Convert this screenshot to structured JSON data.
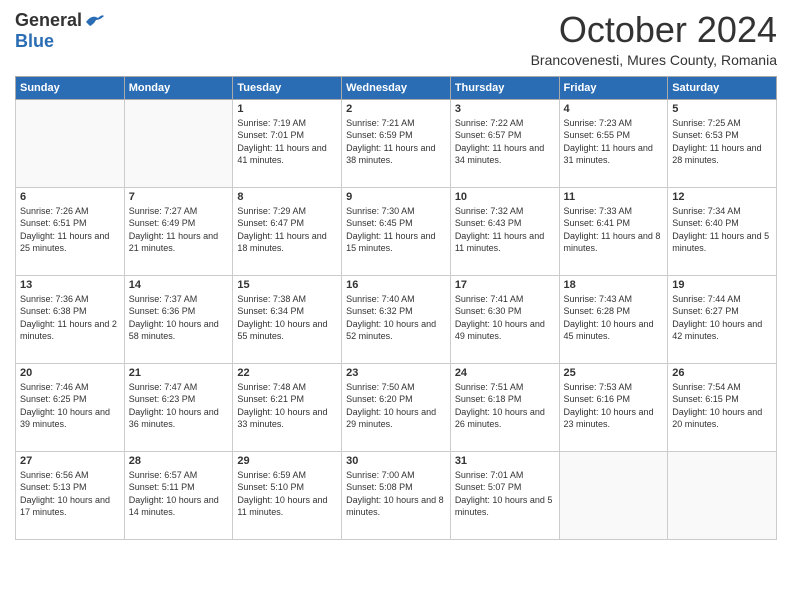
{
  "logo": {
    "general": "General",
    "blue": "Blue"
  },
  "header": {
    "month": "October 2024",
    "location": "Brancovenesti, Mures County, Romania"
  },
  "weekdays": [
    "Sunday",
    "Monday",
    "Tuesday",
    "Wednesday",
    "Thursday",
    "Friday",
    "Saturday"
  ],
  "weeks": [
    [
      {
        "day": "",
        "sunrise": "",
        "sunset": "",
        "daylight": ""
      },
      {
        "day": "",
        "sunrise": "",
        "sunset": "",
        "daylight": ""
      },
      {
        "day": "1",
        "sunrise": "Sunrise: 7:19 AM",
        "sunset": "Sunset: 7:01 PM",
        "daylight": "Daylight: 11 hours and 41 minutes."
      },
      {
        "day": "2",
        "sunrise": "Sunrise: 7:21 AM",
        "sunset": "Sunset: 6:59 PM",
        "daylight": "Daylight: 11 hours and 38 minutes."
      },
      {
        "day": "3",
        "sunrise": "Sunrise: 7:22 AM",
        "sunset": "Sunset: 6:57 PM",
        "daylight": "Daylight: 11 hours and 34 minutes."
      },
      {
        "day": "4",
        "sunrise": "Sunrise: 7:23 AM",
        "sunset": "Sunset: 6:55 PM",
        "daylight": "Daylight: 11 hours and 31 minutes."
      },
      {
        "day": "5",
        "sunrise": "Sunrise: 7:25 AM",
        "sunset": "Sunset: 6:53 PM",
        "daylight": "Daylight: 11 hours and 28 minutes."
      }
    ],
    [
      {
        "day": "6",
        "sunrise": "Sunrise: 7:26 AM",
        "sunset": "Sunset: 6:51 PM",
        "daylight": "Daylight: 11 hours and 25 minutes."
      },
      {
        "day": "7",
        "sunrise": "Sunrise: 7:27 AM",
        "sunset": "Sunset: 6:49 PM",
        "daylight": "Daylight: 11 hours and 21 minutes."
      },
      {
        "day": "8",
        "sunrise": "Sunrise: 7:29 AM",
        "sunset": "Sunset: 6:47 PM",
        "daylight": "Daylight: 11 hours and 18 minutes."
      },
      {
        "day": "9",
        "sunrise": "Sunrise: 7:30 AM",
        "sunset": "Sunset: 6:45 PM",
        "daylight": "Daylight: 11 hours and 15 minutes."
      },
      {
        "day": "10",
        "sunrise": "Sunrise: 7:32 AM",
        "sunset": "Sunset: 6:43 PM",
        "daylight": "Daylight: 11 hours and 11 minutes."
      },
      {
        "day": "11",
        "sunrise": "Sunrise: 7:33 AM",
        "sunset": "Sunset: 6:41 PM",
        "daylight": "Daylight: 11 hours and 8 minutes."
      },
      {
        "day": "12",
        "sunrise": "Sunrise: 7:34 AM",
        "sunset": "Sunset: 6:40 PM",
        "daylight": "Daylight: 11 hours and 5 minutes."
      }
    ],
    [
      {
        "day": "13",
        "sunrise": "Sunrise: 7:36 AM",
        "sunset": "Sunset: 6:38 PM",
        "daylight": "Daylight: 11 hours and 2 minutes."
      },
      {
        "day": "14",
        "sunrise": "Sunrise: 7:37 AM",
        "sunset": "Sunset: 6:36 PM",
        "daylight": "Daylight: 10 hours and 58 minutes."
      },
      {
        "day": "15",
        "sunrise": "Sunrise: 7:38 AM",
        "sunset": "Sunset: 6:34 PM",
        "daylight": "Daylight: 10 hours and 55 minutes."
      },
      {
        "day": "16",
        "sunrise": "Sunrise: 7:40 AM",
        "sunset": "Sunset: 6:32 PM",
        "daylight": "Daylight: 10 hours and 52 minutes."
      },
      {
        "day": "17",
        "sunrise": "Sunrise: 7:41 AM",
        "sunset": "Sunset: 6:30 PM",
        "daylight": "Daylight: 10 hours and 49 minutes."
      },
      {
        "day": "18",
        "sunrise": "Sunrise: 7:43 AM",
        "sunset": "Sunset: 6:28 PM",
        "daylight": "Daylight: 10 hours and 45 minutes."
      },
      {
        "day": "19",
        "sunrise": "Sunrise: 7:44 AM",
        "sunset": "Sunset: 6:27 PM",
        "daylight": "Daylight: 10 hours and 42 minutes."
      }
    ],
    [
      {
        "day": "20",
        "sunrise": "Sunrise: 7:46 AM",
        "sunset": "Sunset: 6:25 PM",
        "daylight": "Daylight: 10 hours and 39 minutes."
      },
      {
        "day": "21",
        "sunrise": "Sunrise: 7:47 AM",
        "sunset": "Sunset: 6:23 PM",
        "daylight": "Daylight: 10 hours and 36 minutes."
      },
      {
        "day": "22",
        "sunrise": "Sunrise: 7:48 AM",
        "sunset": "Sunset: 6:21 PM",
        "daylight": "Daylight: 10 hours and 33 minutes."
      },
      {
        "day": "23",
        "sunrise": "Sunrise: 7:50 AM",
        "sunset": "Sunset: 6:20 PM",
        "daylight": "Daylight: 10 hours and 29 minutes."
      },
      {
        "day": "24",
        "sunrise": "Sunrise: 7:51 AM",
        "sunset": "Sunset: 6:18 PM",
        "daylight": "Daylight: 10 hours and 26 minutes."
      },
      {
        "day": "25",
        "sunrise": "Sunrise: 7:53 AM",
        "sunset": "Sunset: 6:16 PM",
        "daylight": "Daylight: 10 hours and 23 minutes."
      },
      {
        "day": "26",
        "sunrise": "Sunrise: 7:54 AM",
        "sunset": "Sunset: 6:15 PM",
        "daylight": "Daylight: 10 hours and 20 minutes."
      }
    ],
    [
      {
        "day": "27",
        "sunrise": "Sunrise: 6:56 AM",
        "sunset": "Sunset: 5:13 PM",
        "daylight": "Daylight: 10 hours and 17 minutes."
      },
      {
        "day": "28",
        "sunrise": "Sunrise: 6:57 AM",
        "sunset": "Sunset: 5:11 PM",
        "daylight": "Daylight: 10 hours and 14 minutes."
      },
      {
        "day": "29",
        "sunrise": "Sunrise: 6:59 AM",
        "sunset": "Sunset: 5:10 PM",
        "daylight": "Daylight: 10 hours and 11 minutes."
      },
      {
        "day": "30",
        "sunrise": "Sunrise: 7:00 AM",
        "sunset": "Sunset: 5:08 PM",
        "daylight": "Daylight: 10 hours and 8 minutes."
      },
      {
        "day": "31",
        "sunrise": "Sunrise: 7:01 AM",
        "sunset": "Sunset: 5:07 PM",
        "daylight": "Daylight: 10 hours and 5 minutes."
      },
      {
        "day": "",
        "sunrise": "",
        "sunset": "",
        "daylight": ""
      },
      {
        "day": "",
        "sunrise": "",
        "sunset": "",
        "daylight": ""
      }
    ]
  ]
}
